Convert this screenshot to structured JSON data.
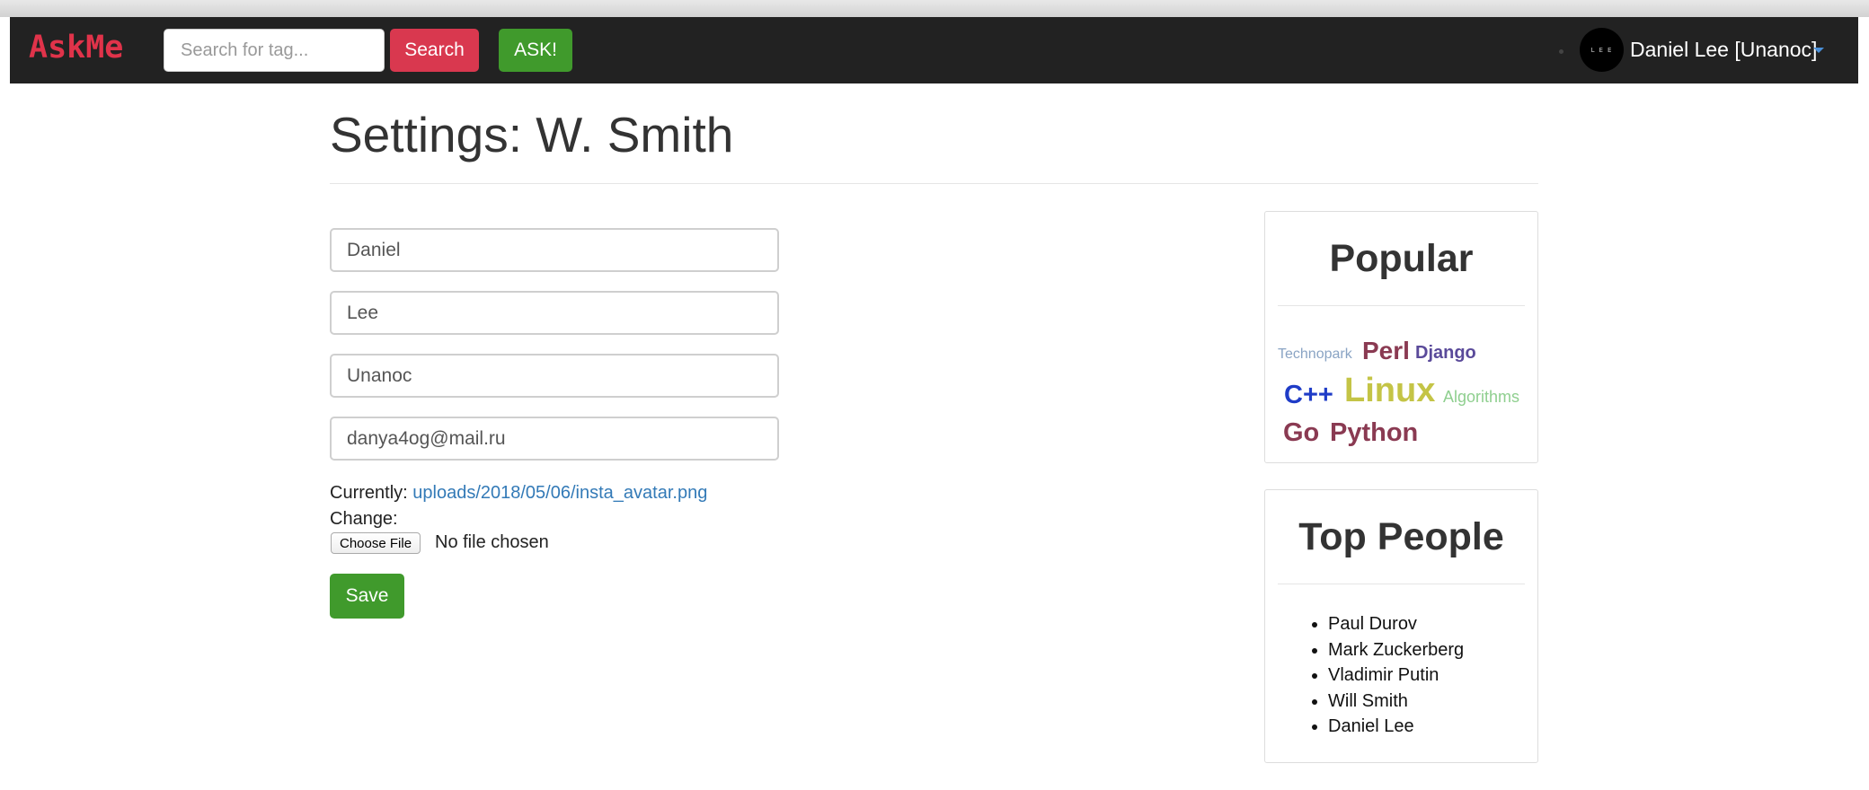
{
  "navbar": {
    "brand": "AskMe",
    "search_placeholder": "Search for tag...",
    "search_button": "Search",
    "ask_button": "ASK!",
    "avatar_text": "LEE",
    "user_name": "Daniel Lee [Unanoc]"
  },
  "page": {
    "title": "Settings: W. Smith"
  },
  "form": {
    "first_name": "Daniel",
    "last_name": "Lee",
    "nickname": "Unanoc",
    "email": "danya4og@mail.ru",
    "currently_label": "Currently:",
    "avatar_path": "uploads/2018/05/06/insta_avatar.png",
    "change_label": "Change:",
    "choose_file_button": "Choose File",
    "no_file_text": "No file chosen",
    "save_button": "Save"
  },
  "sidebar": {
    "popular": {
      "title": "Popular",
      "tags": [
        {
          "label": "Technopark",
          "color": "#8aa4c4"
        },
        {
          "label": "Perl",
          "color": "#8a3a52"
        },
        {
          "label": "Django",
          "color": "#5a4a9a"
        },
        {
          "label": "C++",
          "color": "#1f3cc7"
        },
        {
          "label": "Linux",
          "color": "#c4c446"
        },
        {
          "label": "Algorithms",
          "color": "#8fcf8f"
        },
        {
          "label": "Go",
          "color": "#8a3a52"
        },
        {
          "label": "Python",
          "color": "#8a3a52"
        }
      ]
    },
    "top_people": {
      "title": "Top People",
      "people": [
        "Paul Durov",
        "Mark Zuckerberg",
        "Vladimir Putin",
        "Will Smith",
        "Daniel Lee"
      ]
    }
  }
}
